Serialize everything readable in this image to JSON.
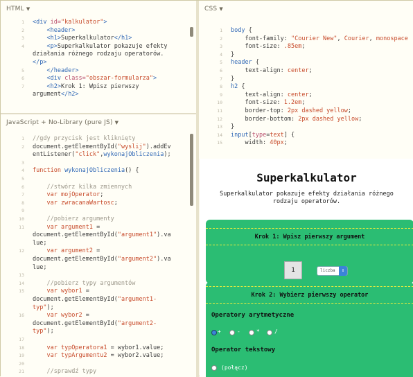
{
  "html_panel": {
    "title": "HTML",
    "lines": [
      {
        "n": "1",
        "parts": [
          [
            "tag",
            "<div "
          ],
          [
            "attr",
            "id="
          ],
          [
            "str",
            "\"kalkulator\""
          ],
          [
            "tag",
            ">"
          ]
        ]
      },
      {
        "n": "2",
        "parts": [
          [
            "tag",
            "    <header>"
          ]
        ]
      },
      {
        "n": "3",
        "parts": [
          [
            "tag",
            "    <h1>"
          ],
          [
            "txt",
            "Superkalkulator"
          ],
          [
            "tag",
            "</h1>"
          ]
        ]
      },
      {
        "n": "4",
        "parts": [
          [
            "tag",
            "    <p>"
          ],
          [
            "txt",
            "Superkalkulator pokazuje efekty"
          ]
        ]
      },
      {
        "n": "",
        "parts": [
          [
            "txt",
            "działania różnego rodzaju operatorów."
          ]
        ]
      },
      {
        "n": "",
        "parts": [
          [
            "tag",
            "</p>"
          ]
        ]
      },
      {
        "n": "5",
        "parts": [
          [
            "tag",
            "    </header>"
          ]
        ]
      },
      {
        "n": "6",
        "parts": [
          [
            "tag",
            "    <div "
          ],
          [
            "attr",
            "class="
          ],
          [
            "str",
            "\"obszar-formularza\""
          ],
          [
            "tag",
            ">"
          ]
        ]
      },
      {
        "n": "7",
        "parts": [
          [
            "tag",
            "    <h2>"
          ],
          [
            "txt",
            "Krok 1: Wpisz pierwszy"
          ]
        ]
      },
      {
        "n": "",
        "parts": [
          [
            "txt",
            "argument"
          ],
          [
            "tag",
            "</h2>"
          ]
        ]
      }
    ]
  },
  "js_panel": {
    "title": "JavaScript + No-Library (pure JS)",
    "lines": [
      {
        "n": "1",
        "parts": [
          [
            "cm",
            "//gdy przycisk jest kliknięty"
          ]
        ]
      },
      {
        "n": "2",
        "parts": [
          [
            "txt",
            "document.getElementById("
          ],
          [
            "str",
            "\"wyslij\""
          ],
          [
            "txt",
            ").addEv"
          ]
        ]
      },
      {
        "n": "",
        "parts": [
          [
            "txt",
            "entListener("
          ],
          [
            "str",
            "\"click\""
          ],
          [
            "txt",
            ","
          ],
          [
            "fn",
            "wykonajObliczenia"
          ],
          [
            "txt",
            ");"
          ]
        ]
      },
      {
        "n": "3",
        "parts": [
          [
            "txt",
            ""
          ]
        ]
      },
      {
        "n": "4",
        "parts": [
          [
            "kw",
            "function "
          ],
          [
            "fn",
            "wykonajObliczenia"
          ],
          [
            "txt",
            "() {"
          ]
        ]
      },
      {
        "n": "5",
        "parts": [
          [
            "txt",
            ""
          ]
        ]
      },
      {
        "n": "6",
        "parts": [
          [
            "cm",
            "    //stwórz kilka zmiennych"
          ]
        ]
      },
      {
        "n": "7",
        "parts": [
          [
            "kw",
            "    var "
          ],
          [
            "val",
            "mojOperator"
          ],
          [
            "txt",
            ";"
          ]
        ]
      },
      {
        "n": "8",
        "parts": [
          [
            "kw",
            "    var "
          ],
          [
            "val",
            "zwracanaWartosc"
          ],
          [
            "txt",
            ";"
          ]
        ]
      },
      {
        "n": "9",
        "parts": [
          [
            "txt",
            ""
          ]
        ]
      },
      {
        "n": "10",
        "parts": [
          [
            "cm",
            "    //pobierz argumenty"
          ]
        ]
      },
      {
        "n": "11",
        "parts": [
          [
            "kw",
            "    var "
          ],
          [
            "val",
            "argument1"
          ],
          [
            "txt",
            " ="
          ]
        ]
      },
      {
        "n": "",
        "parts": [
          [
            "txt",
            "document.getElementById("
          ],
          [
            "str",
            "\"argument1\""
          ],
          [
            "txt",
            ").va"
          ]
        ]
      },
      {
        "n": "",
        "parts": [
          [
            "txt",
            "lue;"
          ]
        ]
      },
      {
        "n": "12",
        "parts": [
          [
            "kw",
            "    var "
          ],
          [
            "val",
            "argument2"
          ],
          [
            "txt",
            " ="
          ]
        ]
      },
      {
        "n": "",
        "parts": [
          [
            "txt",
            "document.getElementById("
          ],
          [
            "str",
            "\"argument2\""
          ],
          [
            "txt",
            ").va"
          ]
        ]
      },
      {
        "n": "",
        "parts": [
          [
            "txt",
            "lue;"
          ]
        ]
      },
      {
        "n": "13",
        "parts": [
          [
            "txt",
            ""
          ]
        ]
      },
      {
        "n": "14",
        "parts": [
          [
            "cm",
            "    //pobierz typy argumentów"
          ]
        ]
      },
      {
        "n": "15",
        "parts": [
          [
            "kw",
            "    var "
          ],
          [
            "val",
            "wybor1"
          ],
          [
            "txt",
            " ="
          ]
        ]
      },
      {
        "n": "",
        "parts": [
          [
            "txt",
            "document.getElementById("
          ],
          [
            "str",
            "\"argument1-"
          ]
        ]
      },
      {
        "n": "",
        "parts": [
          [
            "str",
            "typ\""
          ],
          [
            "txt",
            ");"
          ]
        ]
      },
      {
        "n": "16",
        "parts": [
          [
            "kw",
            "    var "
          ],
          [
            "val",
            "wybor2"
          ],
          [
            "txt",
            " ="
          ]
        ]
      },
      {
        "n": "",
        "parts": [
          [
            "txt",
            "document.getElementById("
          ],
          [
            "str",
            "\"argument2-"
          ]
        ]
      },
      {
        "n": "",
        "parts": [
          [
            "str",
            "typ\""
          ],
          [
            "txt",
            ");"
          ]
        ]
      },
      {
        "n": "17",
        "parts": [
          [
            "txt",
            ""
          ]
        ]
      },
      {
        "n": "18",
        "parts": [
          [
            "kw",
            "    var "
          ],
          [
            "val",
            "typOperatora1"
          ],
          [
            "txt",
            " = wybor1.value;"
          ]
        ]
      },
      {
        "n": "19",
        "parts": [
          [
            "kw",
            "    var "
          ],
          [
            "val",
            "typArgumentu2"
          ],
          [
            "txt",
            " = wybor2.value;"
          ]
        ]
      },
      {
        "n": "20",
        "parts": [
          [
            "txt",
            ""
          ]
        ]
      },
      {
        "n": "21",
        "parts": [
          [
            "cm",
            "    //sprawdź typy"
          ]
        ]
      }
    ]
  },
  "css_panel": {
    "title": "CSS",
    "lines": [
      {
        "n": "1",
        "parts": [
          [
            "sel",
            "body"
          ],
          [
            "txt",
            " {"
          ]
        ]
      },
      {
        "n": "2",
        "parts": [
          [
            "prop",
            "    font-family: "
          ],
          [
            "str",
            "\"Courier New\""
          ],
          [
            "txt",
            ", "
          ],
          [
            "val",
            "Courier"
          ],
          [
            "txt",
            ", "
          ],
          [
            "val",
            "monospace"
          ]
        ]
      },
      {
        "n": "3",
        "parts": [
          [
            "prop",
            "    font-size: "
          ],
          [
            "val",
            ".85em"
          ],
          [
            "txt",
            ";"
          ]
        ]
      },
      {
        "n": "4",
        "parts": [
          [
            "txt",
            "}"
          ]
        ]
      },
      {
        "n": "5",
        "parts": [
          [
            "sel",
            "header"
          ],
          [
            "txt",
            " {"
          ]
        ]
      },
      {
        "n": "6",
        "parts": [
          [
            "prop",
            "    text-align: "
          ],
          [
            "val",
            "center"
          ],
          [
            "txt",
            ";"
          ]
        ]
      },
      {
        "n": "7",
        "parts": [
          [
            "txt",
            "}"
          ]
        ]
      },
      {
        "n": "8",
        "parts": [
          [
            "sel",
            "h2"
          ],
          [
            "txt",
            " {"
          ]
        ]
      },
      {
        "n": "9",
        "parts": [
          [
            "prop",
            "    text-align: "
          ],
          [
            "val",
            "center"
          ],
          [
            "txt",
            ";"
          ]
        ]
      },
      {
        "n": "10",
        "parts": [
          [
            "prop",
            "    font-size: "
          ],
          [
            "val",
            "1.2em"
          ],
          [
            "txt",
            ";"
          ]
        ]
      },
      {
        "n": "11",
        "parts": [
          [
            "prop",
            "    border-top: "
          ],
          [
            "val",
            "2px dashed yellow"
          ],
          [
            "txt",
            ";"
          ]
        ]
      },
      {
        "n": "12",
        "parts": [
          [
            "prop",
            "    border-bottom: "
          ],
          [
            "val",
            "2px dashed yellow"
          ],
          [
            "txt",
            ";"
          ]
        ]
      },
      {
        "n": "13",
        "parts": [
          [
            "txt",
            "}"
          ]
        ]
      },
      {
        "n": "14",
        "parts": [
          [
            "sel",
            "input"
          ],
          [
            "txt",
            "["
          ],
          [
            "attr",
            "type"
          ],
          [
            "txt",
            "="
          ],
          [
            "val",
            "text"
          ],
          [
            "txt",
            "] {"
          ]
        ]
      },
      {
        "n": "15",
        "parts": [
          [
            "prop",
            "    width: "
          ],
          [
            "val",
            "40px"
          ],
          [
            "txt",
            ";"
          ]
        ]
      }
    ]
  },
  "result": {
    "title": "Superkalkulator",
    "intro": "Superkalkulator pokazuje efekty działania różnego\nrodzaju operatorów.",
    "step1": {
      "heading": "Krok 1: Wpisz pierwszy argument",
      "value": "1",
      "select": "liczba"
    },
    "step2": {
      "heading": "Krok 2: Wybierz pierwszy operator",
      "arith_label": "Operatory arytmetyczne",
      "ops": [
        "+",
        "-",
        "*",
        "/"
      ],
      "text_label": "Operator tekstowy",
      "text_op": "(połącz)"
    }
  },
  "colors": {
    "accent_green": "#2bbd73",
    "dash_yellow": "#f3ef3a",
    "panel_bg": "#fffef6"
  }
}
